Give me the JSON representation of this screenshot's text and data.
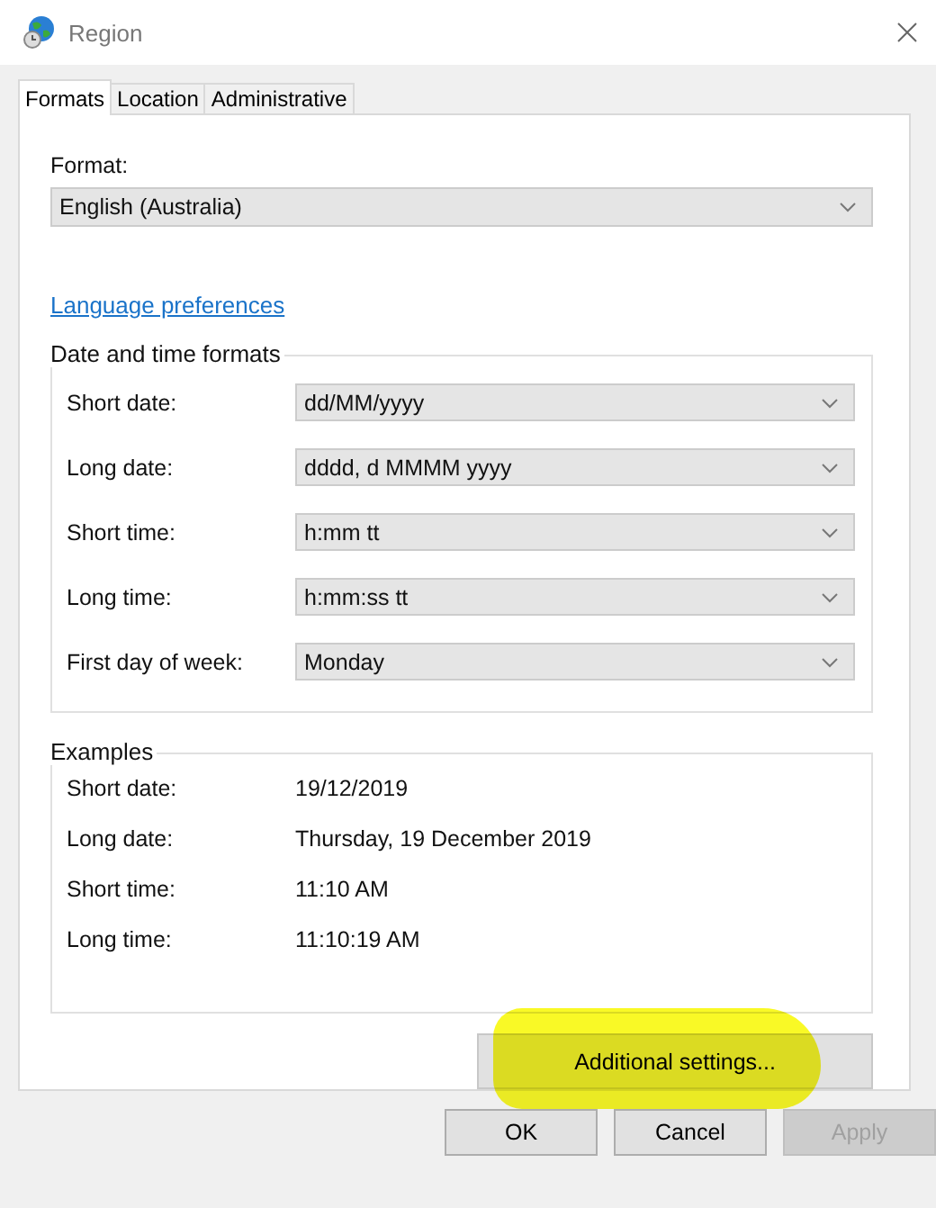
{
  "window": {
    "title": "Region"
  },
  "tabs": [
    {
      "label": "Formats",
      "selected": true
    },
    {
      "label": "Location",
      "selected": false
    },
    {
      "label": "Administrative",
      "selected": false
    }
  ],
  "format": {
    "label": "Format:",
    "value": "English (Australia)"
  },
  "language_link": "Language preferences",
  "date_time_formats": {
    "title": "Date and time formats",
    "rows": [
      {
        "label": "Short date:",
        "value": "dd/MM/yyyy"
      },
      {
        "label": "Long date:",
        "value": "dddd, d MMMM yyyy"
      },
      {
        "label": "Short time:",
        "value": "h:mm tt"
      },
      {
        "label": "Long time:",
        "value": "h:mm:ss tt"
      },
      {
        "label": "First day of week:",
        "value": "Monday"
      }
    ]
  },
  "examples": {
    "title": "Examples",
    "rows": [
      {
        "label": "Short date:",
        "value": "19/12/2019"
      },
      {
        "label": "Long date:",
        "value": "Thursday, 19 December 2019"
      },
      {
        "label": "Short time:",
        "value": "11:10 AM"
      },
      {
        "label": "Long time:",
        "value": "11:10:19 AM"
      }
    ]
  },
  "additional_settings": {
    "label": "Additional settings...",
    "highlighted": true
  },
  "buttons": [
    {
      "label": "OK",
      "disabled": false
    },
    {
      "label": "Cancel",
      "disabled": false
    },
    {
      "label": "Apply",
      "disabled": true
    }
  ]
}
